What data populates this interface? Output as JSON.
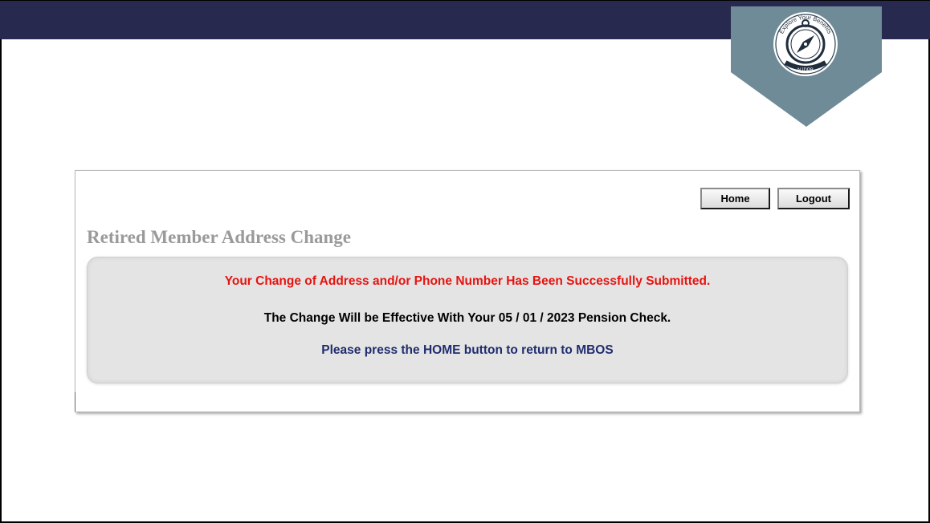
{
  "header": {
    "bar_color": "#272a4e",
    "logo": {
      "ring_text": "Explore Your Benefits",
      "bottom_text": "NJDPB",
      "icon": "compass-icon",
      "badge_color": "#6f8b97"
    }
  },
  "toolbar": {
    "home_label": "Home",
    "logout_label": "Logout"
  },
  "page": {
    "title": "Retired Member Address Change"
  },
  "messages": {
    "success": "Your Change of Address and/or Phone Number Has Been Successfully Submitted.",
    "effective": "The Change Will be Effective With Your 05 / 01 / 2023 Pension Check.",
    "instruction": "Please press the HOME button to return to MBOS"
  },
  "colors": {
    "success_text": "#e8130f",
    "instruction_text": "#1f2d6e",
    "title_text": "#9a9a9a",
    "panel_bg": "#e4e4e4"
  }
}
